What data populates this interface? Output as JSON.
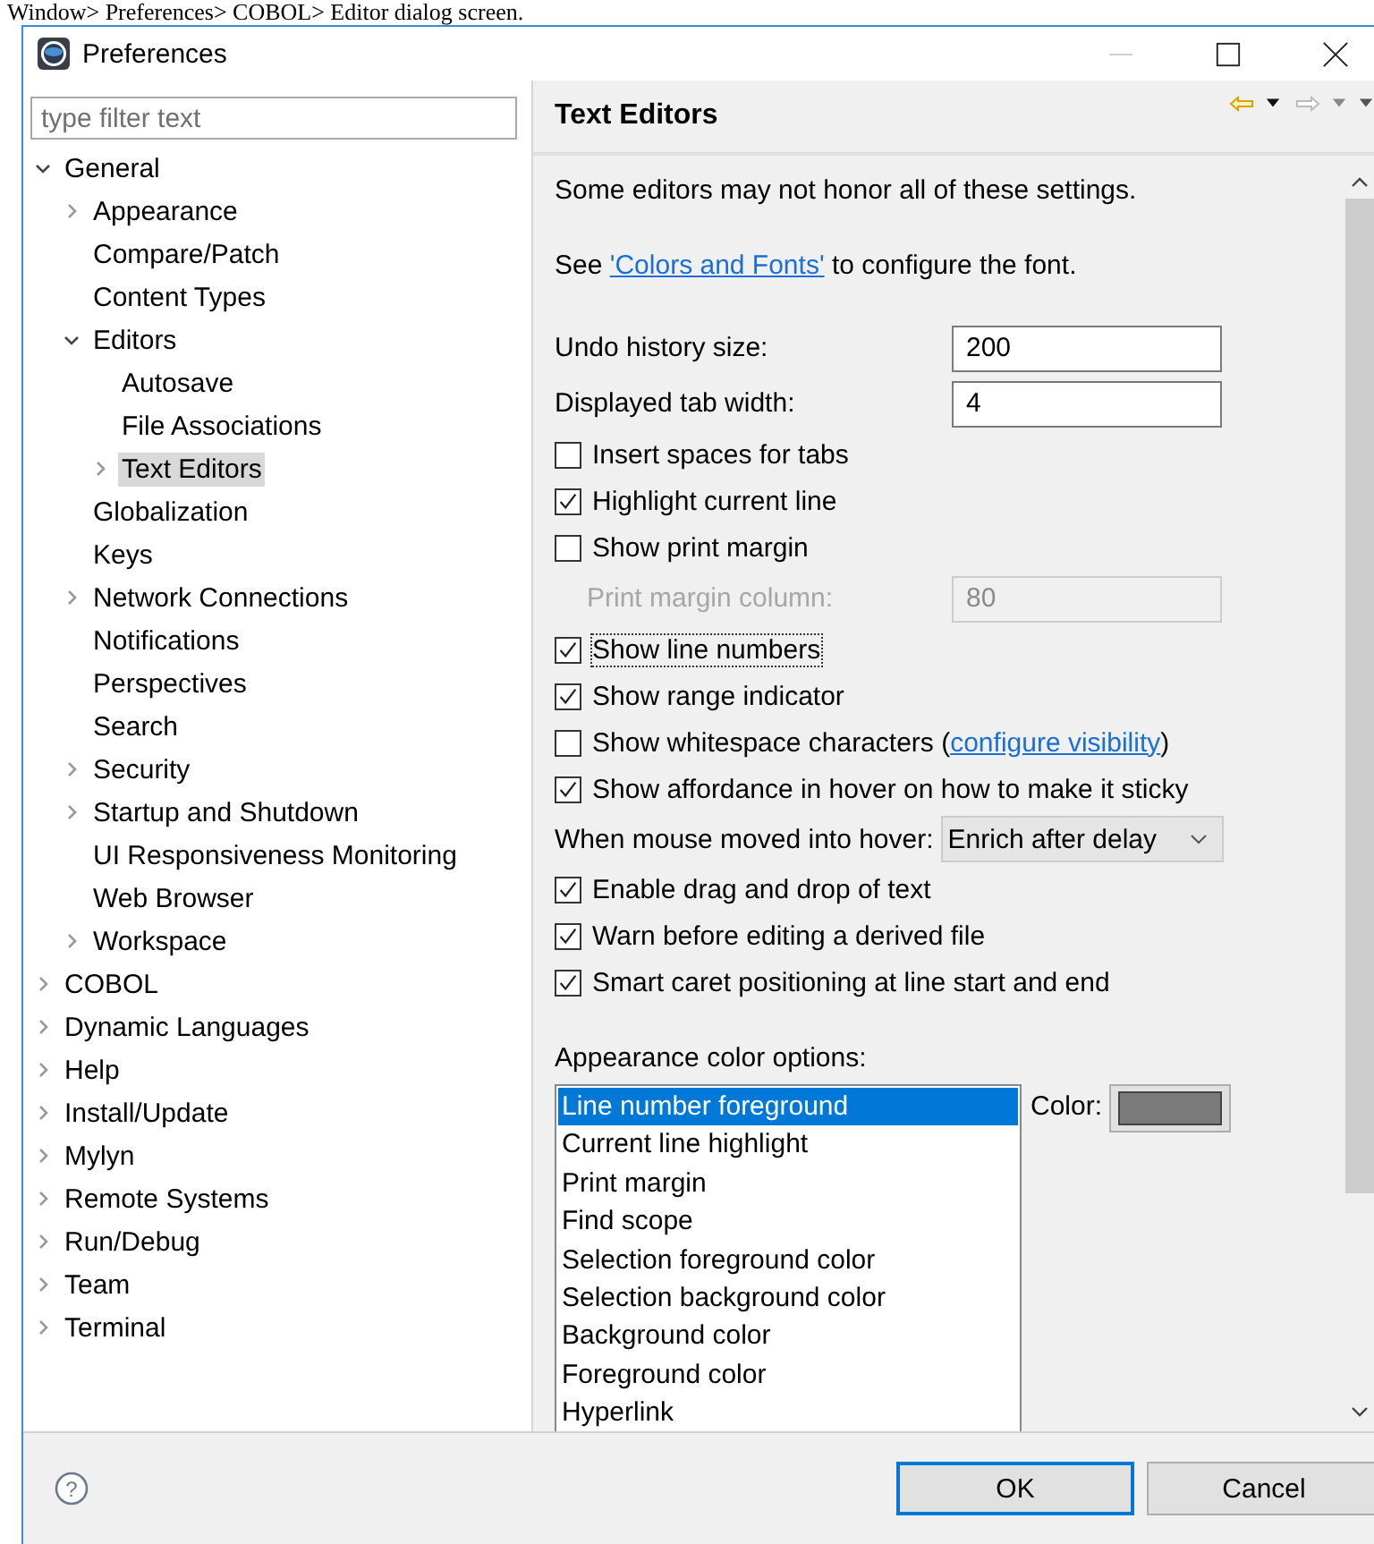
{
  "caption": "Window> Preferences> COBOL> Editor dialog screen.",
  "window": {
    "title": "Preferences"
  },
  "filter": {
    "placeholder": "type filter text"
  },
  "tree": {
    "items": [
      {
        "label": "General",
        "kind": "expanded",
        "selected": false,
        "children": [
          {
            "label": "Appearance",
            "kind": "collapsed",
            "selected": false
          },
          {
            "label": "Compare/Patch",
            "kind": "leaf",
            "selected": false
          },
          {
            "label": "Content Types",
            "kind": "leaf",
            "selected": false
          },
          {
            "label": "Editors",
            "kind": "expanded",
            "selected": false,
            "children": [
              {
                "label": "Autosave",
                "kind": "leaf",
                "selected": false
              },
              {
                "label": "File Associations",
                "kind": "leaf",
                "selected": false
              },
              {
                "label": "Text Editors",
                "kind": "collapsed",
                "selected": true
              }
            ]
          },
          {
            "label": "Globalization",
            "kind": "leaf",
            "selected": false
          },
          {
            "label": "Keys",
            "kind": "leaf",
            "selected": false
          },
          {
            "label": "Network Connections",
            "kind": "collapsed",
            "selected": false
          },
          {
            "label": "Notifications",
            "kind": "leaf",
            "selected": false
          },
          {
            "label": "Perspectives",
            "kind": "leaf",
            "selected": false
          },
          {
            "label": "Search",
            "kind": "leaf",
            "selected": false
          },
          {
            "label": "Security",
            "kind": "collapsed",
            "selected": false
          },
          {
            "label": "Startup and Shutdown",
            "kind": "collapsed",
            "selected": false
          },
          {
            "label": "UI Responsiveness Monitoring",
            "kind": "leaf",
            "selected": false
          },
          {
            "label": "Web Browser",
            "kind": "leaf",
            "selected": false
          },
          {
            "label": "Workspace",
            "kind": "collapsed",
            "selected": false
          }
        ]
      },
      {
        "label": "COBOL",
        "kind": "collapsed",
        "selected": false
      },
      {
        "label": "Dynamic Languages",
        "kind": "collapsed",
        "selected": false
      },
      {
        "label": "Help",
        "kind": "collapsed",
        "selected": false
      },
      {
        "label": "Install/Update",
        "kind": "collapsed",
        "selected": false
      },
      {
        "label": "Mylyn",
        "kind": "collapsed",
        "selected": false
      },
      {
        "label": "Remote Systems",
        "kind": "collapsed",
        "selected": false
      },
      {
        "label": "Run/Debug",
        "kind": "collapsed",
        "selected": false
      },
      {
        "label": "Team",
        "kind": "collapsed",
        "selected": false
      },
      {
        "label": "Terminal",
        "kind": "collapsed",
        "selected": false
      }
    ]
  },
  "page": {
    "title": "Text Editors",
    "settings": [
      {
        "kind": "text",
        "text": "Some editors may not honor all of these settings."
      },
      {
        "kind": "link_text",
        "before": "See ",
        "link": "'Colors and Fonts'",
        "after": " to configure the font."
      },
      {
        "kind": "number_field",
        "label": "Undo history size:",
        "value": "200",
        "disabled": false
      },
      {
        "kind": "number_field",
        "label": "Displayed tab width:",
        "value": "4",
        "disabled": false
      },
      {
        "kind": "checkbox",
        "label": "Insert spaces for tabs",
        "checked": false,
        "focused": false
      },
      {
        "kind": "checkbox",
        "label": "Highlight current line",
        "checked": true,
        "focused": false
      },
      {
        "kind": "checkbox",
        "label": "Show print margin",
        "checked": false,
        "focused": false
      },
      {
        "kind": "number_field",
        "label": "Print margin column:",
        "value": "80",
        "disabled": true
      },
      {
        "kind": "checkbox",
        "label": "Show line numbers",
        "checked": true,
        "focused": true
      },
      {
        "kind": "checkbox",
        "label": "Show range indicator",
        "checked": true,
        "focused": false
      },
      {
        "kind": "checkbox",
        "label": "Show whitespace characters (",
        "link": "configure visibility",
        "after": ")",
        "checked": false,
        "focused": false
      },
      {
        "kind": "checkbox",
        "label": "Show affordance in hover on how to make it sticky",
        "checked": true,
        "focused": false
      },
      {
        "kind": "dropdown",
        "label": "When mouse moved into hover:",
        "value": "Enrich after delay"
      },
      {
        "kind": "checkbox",
        "label": "Enable drag and drop of text",
        "checked": true,
        "focused": false
      },
      {
        "kind": "checkbox",
        "label": "Warn before editing a derived file",
        "checked": true,
        "focused": false
      },
      {
        "kind": "checkbox",
        "label": "Smart caret positioning at line start and end",
        "checked": true,
        "focused": false
      }
    ],
    "color_options": {
      "label": "Appearance color options:",
      "items": [
        {
          "label": "Line number foreground",
          "selected": true
        },
        {
          "label": "Current line highlight",
          "selected": false
        },
        {
          "label": "Print margin",
          "selected": false
        },
        {
          "label": "Find scope",
          "selected": false
        },
        {
          "label": "Selection foreground color",
          "selected": false
        },
        {
          "label": "Selection background color",
          "selected": false
        },
        {
          "label": "Background color",
          "selected": false
        },
        {
          "label": "Foreground color",
          "selected": false
        },
        {
          "label": "Hyperlink",
          "selected": false
        }
      ],
      "color_label": "Color:",
      "color": "#7a7a7a"
    }
  },
  "help": {
    "glyph": "?"
  },
  "buttons": [
    {
      "label": "OK",
      "default": true
    },
    {
      "label": "Cancel",
      "default": false
    }
  ]
}
